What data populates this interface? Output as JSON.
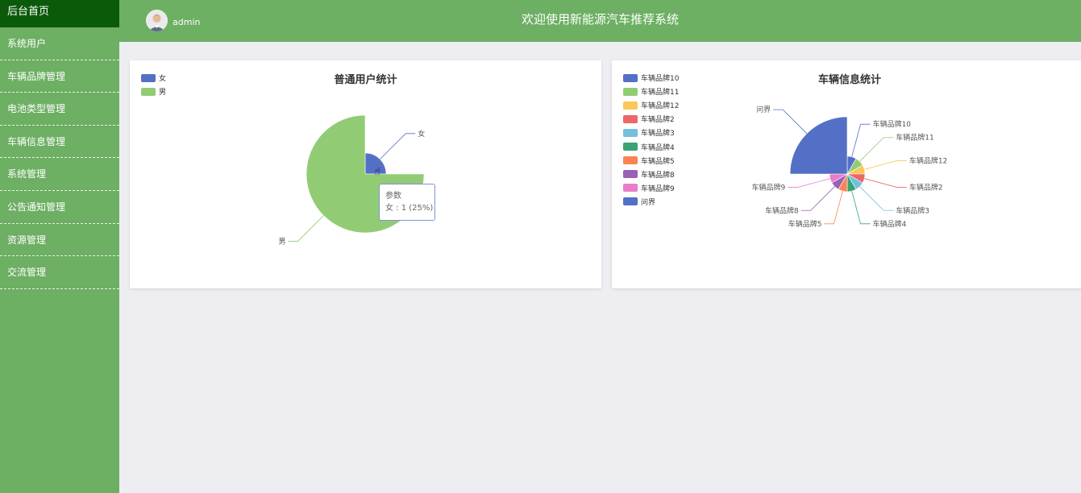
{
  "sidebar": {
    "home": "后台首页",
    "items": [
      "系统用户",
      "车辆品牌管理",
      "电池类型管理",
      "车辆信息管理",
      "系统管理",
      "公告通知管理",
      "资源管理",
      "交流管理"
    ]
  },
  "header": {
    "username": "admin",
    "title": "欢迎使用新能源汽车推荐系统"
  },
  "colors": {
    "accent": "#6daf63",
    "home_active": "#0a5a0a",
    "female": "#5470c6",
    "male": "#91cc75"
  },
  "user_chart": {
    "title": "普通用户统计",
    "legend": [
      "女",
      "男"
    ],
    "tooltip": {
      "series": "参数",
      "label": "女 : 1 (25%)"
    }
  },
  "vehicle_chart": {
    "title": "车辆信息统计",
    "legend": [
      "车辆品牌10",
      "车辆品牌11",
      "车辆品牌12",
      "车辆品牌2",
      "车辆品牌3",
      "车辆品牌4",
      "车辆品牌5",
      "车辆品牌8",
      "车辆品牌9",
      "问界"
    ]
  },
  "chart_data": [
    {
      "type": "pie",
      "title": "普通用户统计",
      "rose_type": "radius",
      "legend_position": "top-left",
      "slices": [
        {
          "name": "女",
          "value": 1,
          "percent": 25,
          "color": "#5470c6"
        },
        {
          "name": "男",
          "value": 3,
          "percent": 75,
          "color": "#91cc75"
        }
      ]
    },
    {
      "type": "pie",
      "title": "车辆信息统计",
      "rose_type": "radius",
      "legend_position": "top-left",
      "slices": [
        {
          "name": "车辆品牌10",
          "value": 1,
          "color": "#5470c6"
        },
        {
          "name": "车辆品牌11",
          "value": 1,
          "color": "#91cc75"
        },
        {
          "name": "车辆品牌12",
          "value": 1,
          "color": "#fac858"
        },
        {
          "name": "车辆品牌2",
          "value": 1,
          "color": "#ee6666"
        },
        {
          "name": "车辆品牌3",
          "value": 1,
          "color": "#73c0de"
        },
        {
          "name": "车辆品牌4",
          "value": 1,
          "color": "#3ba272"
        },
        {
          "name": "车辆品牌5",
          "value": 1,
          "color": "#fc8452"
        },
        {
          "name": "车辆品牌8",
          "value": 1,
          "color": "#9a60b4"
        },
        {
          "name": "车辆品牌9",
          "value": 1,
          "color": "#ea7ccc"
        },
        {
          "name": "问界",
          "value": 3,
          "color": "#5470c6"
        }
      ]
    }
  ]
}
